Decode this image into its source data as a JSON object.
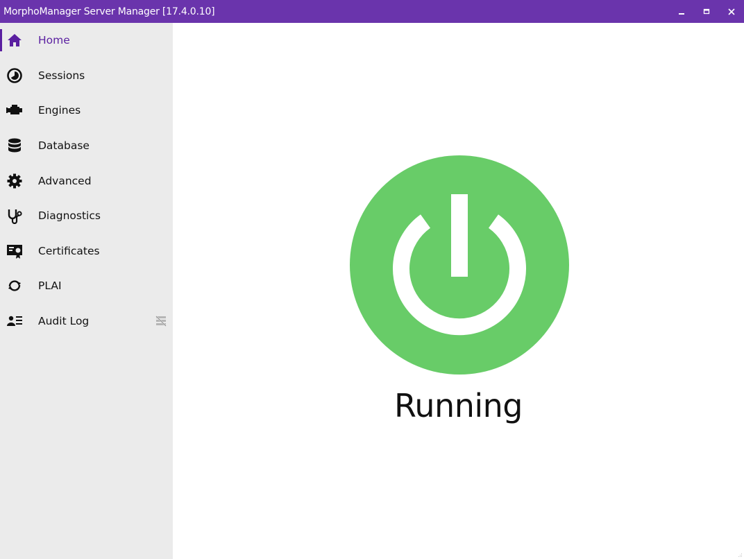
{
  "window": {
    "title": "MorphoManager Server Manager [17.4.0.10]",
    "accent_color": "#6a34ac",
    "controls": {
      "minimize_icon": "minimize-icon",
      "maximize_icon": "maximize-icon",
      "close_icon": "close-icon"
    }
  },
  "sidebar": {
    "active_color": "#5a1fa0",
    "items": [
      {
        "label": "Home",
        "icon": "home-icon",
        "active": true
      },
      {
        "label": "Sessions",
        "icon": "sessions-icon",
        "active": false
      },
      {
        "label": "Engines",
        "icon": "engine-icon",
        "active": false
      },
      {
        "label": "Database",
        "icon": "database-icon",
        "active": false
      },
      {
        "label": "Advanced",
        "icon": "gear-icon",
        "active": false
      },
      {
        "label": "Diagnostics",
        "icon": "stethoscope-icon",
        "active": false
      },
      {
        "label": "Certificates",
        "icon": "certificate-icon",
        "active": false
      },
      {
        "label": "PLAI",
        "icon": "sync-icon",
        "active": false
      },
      {
        "label": "Audit Log",
        "icon": "audit-log-icon",
        "active": false,
        "extra_icon": "disconnected-icon"
      }
    ]
  },
  "main": {
    "status": {
      "text": "Running",
      "icon": "power-icon",
      "color": "#68cc68"
    }
  }
}
